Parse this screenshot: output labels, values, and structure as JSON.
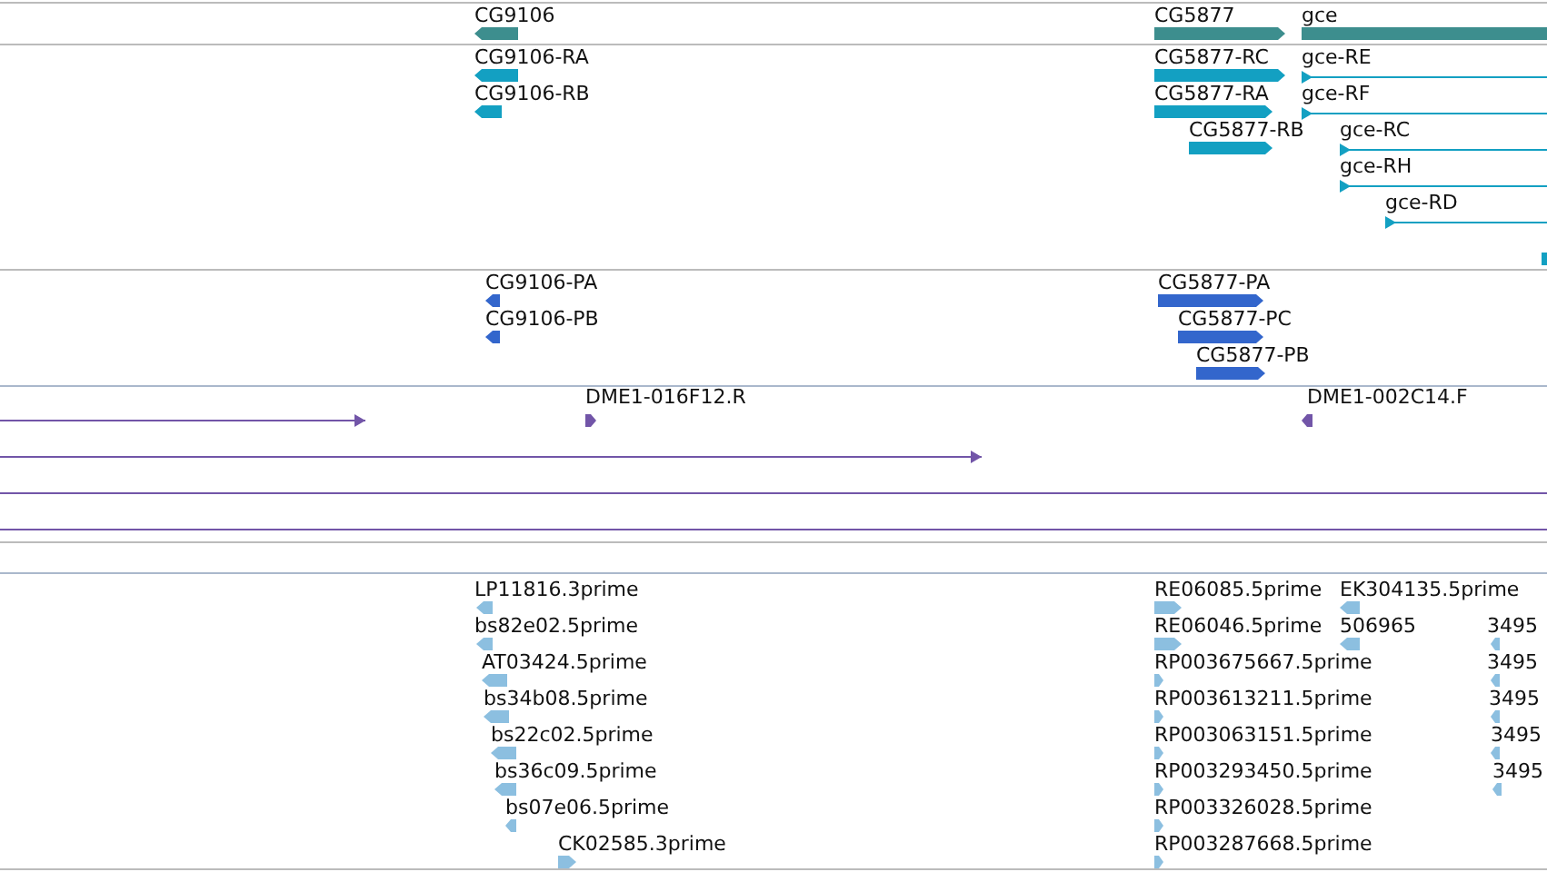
{
  "tracks": [
    {
      "kind": "genes",
      "features": [
        {
          "label": "CG9106",
          "reverse": true
        },
        {
          "label": "CG5877",
          "reverse": false
        },
        {
          "label": "gce"
        }
      ]
    },
    {
      "kind": "transcripts",
      "features": [
        {
          "label": "CG9106-RA",
          "reverse": true
        },
        {
          "label": "CG9106-RB",
          "reverse": true
        },
        {
          "label": "CG5877-RC",
          "reverse": false
        },
        {
          "label": "CG5877-RA",
          "reverse": false
        },
        {
          "label": "CG5877-RB",
          "reverse": false
        },
        {
          "label": "gce-RE",
          "reverse": false
        },
        {
          "label": "gce-RF",
          "reverse": false
        },
        {
          "label": "gce-RC",
          "reverse": false
        },
        {
          "label": "gce-RH",
          "reverse": false
        },
        {
          "label": "gce-RD",
          "reverse": false
        },
        {
          "kind": "plain"
        }
      ]
    },
    {
      "kind": "proteins",
      "features": [
        {
          "label": "CG9106-PA",
          "reverse": true
        },
        {
          "label": "CG9106-PB",
          "reverse": true
        },
        {
          "label": "CG5877-PA",
          "reverse": false
        },
        {
          "label": "CG5877-PC",
          "reverse": false
        },
        {
          "label": "CG5877-PB",
          "reverse": false
        }
      ]
    },
    {
      "kind": "clones",
      "features": [
        {
          "kind": "arrow",
          "reverse": false
        },
        {
          "label": "DME1-016F12.R",
          "kind": "arrow",
          "reverse": false
        },
        {
          "label": "DME1-002C14.F",
          "kind": "arrow",
          "reverse": true
        },
        {
          "kind": "arrow",
          "reverse": false
        },
        {
          "kind": "plain"
        },
        {
          "kind": "plain"
        }
      ]
    },
    {
      "kind": "ests",
      "features": [
        {
          "label": "LP11816.3prime",
          "reverse": true
        },
        {
          "label": "bs82e02.5prime",
          "reverse": true
        },
        {
          "label": "AT03424.5prime",
          "reverse": true
        },
        {
          "label": "bs34b08.5prime",
          "reverse": true
        },
        {
          "label": "bs22c02.5prime",
          "reverse": true
        },
        {
          "label": "bs36c09.5prime",
          "reverse": true
        },
        {
          "label": "bs07e06.5prime",
          "reverse": true
        },
        {
          "label": "CK02585.3prime",
          "reverse": false
        },
        {
          "label": "RE06085.5prime",
          "reverse": false
        },
        {
          "label": "RE06046.5prime",
          "reverse": false
        },
        {
          "label": "RP003675667.5prime",
          "reverse": false
        },
        {
          "label": "RP003613211.5prime",
          "reverse": false
        },
        {
          "label": "RP003063151.5prime",
          "reverse": false
        },
        {
          "label": "RP003293450.5prime",
          "reverse": false
        },
        {
          "label": "RP003326028.5prime",
          "reverse": false
        },
        {
          "label": "RP003287668.5prime",
          "reverse": false
        },
        {
          "label": "EK304135.5prime",
          "reverse": true
        },
        {
          "label": "506965",
          "reverse": true
        },
        {
          "label": "3495",
          "reverse": true
        },
        {
          "label": "3495",
          "reverse": true
        },
        {
          "label": "3495",
          "reverse": true
        },
        {
          "label": "3495",
          "reverse": true
        },
        {
          "label": "3495",
          "reverse": true
        }
      ]
    }
  ]
}
